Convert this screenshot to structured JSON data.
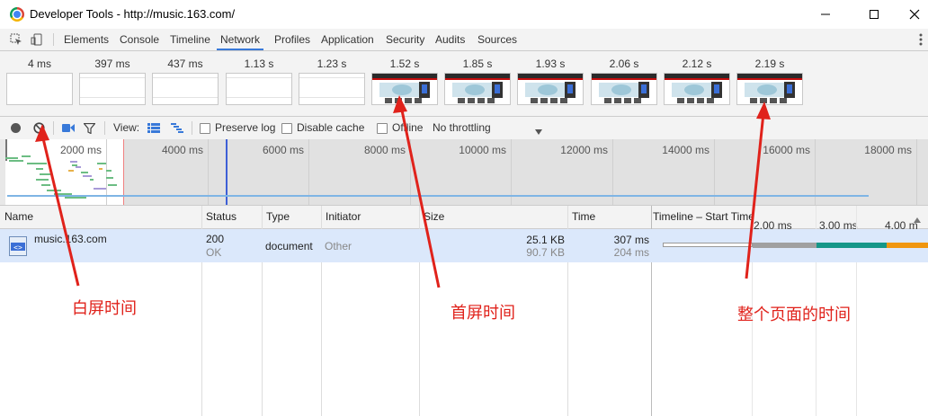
{
  "window": {
    "title": "Developer Tools - http://music.163.com/"
  },
  "tabs": [
    "Elements",
    "Console",
    "Timeline",
    "Network",
    "Profiles",
    "Application",
    "Security",
    "Audits",
    "Sources"
  ],
  "active_tab": "Network",
  "filmstrip": {
    "frames": [
      {
        "time": "4 ms",
        "state": "blank"
      },
      {
        "time": "397 ms",
        "state": "grey"
      },
      {
        "time": "437 ms",
        "state": "grey"
      },
      {
        "time": "1.13 s",
        "state": "grey"
      },
      {
        "time": "1.23 s",
        "state": "grey"
      },
      {
        "time": "1.52 s",
        "state": "page"
      },
      {
        "time": "1.85 s",
        "state": "page"
      },
      {
        "time": "1.93 s",
        "state": "page"
      },
      {
        "time": "2.06 s",
        "state": "page"
      },
      {
        "time": "2.12 s",
        "state": "page"
      },
      {
        "time": "2.19 s",
        "state": "page"
      }
    ]
  },
  "toolbar": {
    "view_label": "View:",
    "preserve_log": "Preserve log",
    "disable_cache": "Disable cache",
    "offline": "Offline",
    "throttling": "No throttling"
  },
  "overview": {
    "ticks": [
      "2000 ms",
      "4000 ms",
      "6000 ms",
      "8000 ms",
      "10000 ms",
      "12000 ms",
      "14000 ms",
      "16000 ms",
      "18000 ms"
    ]
  },
  "table": {
    "columns": {
      "name": "Name",
      "status": "Status",
      "type": "Type",
      "initiator": "Initiator",
      "size": "Size",
      "time": "Time",
      "timeline": "Timeline – Start Time"
    },
    "timeline_ticks": [
      "2.00 ms",
      "3.00 ms",
      "4.00 m"
    ],
    "rows": [
      {
        "name": "music.163.com",
        "status": "200",
        "status_text": "OK",
        "type": "document",
        "initiator": "Other",
        "size": "25.1 KB",
        "content": "90.7 KB",
        "time": "307 ms",
        "latency": "204 ms"
      }
    ]
  },
  "annotations": {
    "white_screen": "白屏时间",
    "first_screen": "首屏时间",
    "full_page": "整个页面的时间"
  },
  "colors": {
    "accent": "#3879d9",
    "annotation": "#e0221b",
    "row_selected": "#dbe8fb"
  }
}
